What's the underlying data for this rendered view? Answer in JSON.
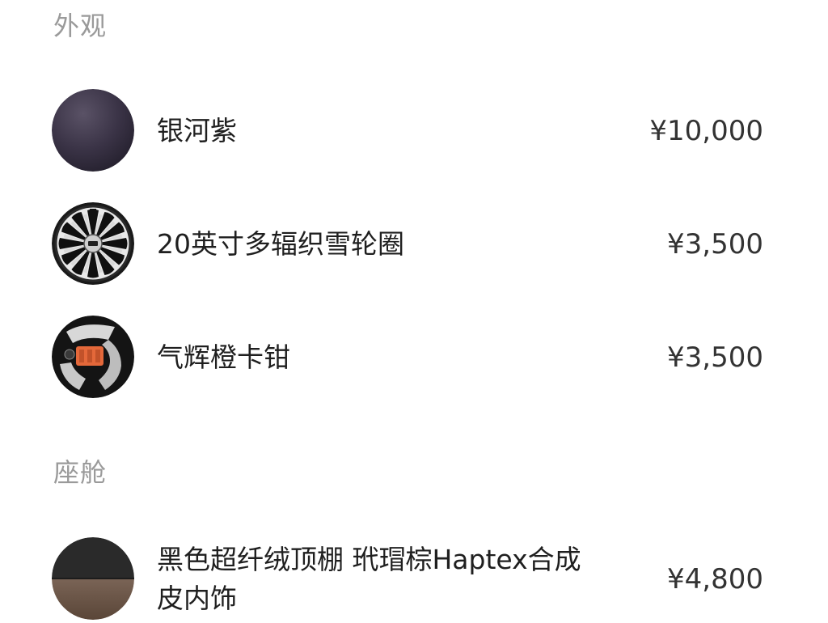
{
  "sections": [
    {
      "title": "外观",
      "items": [
        {
          "name": "银河紫",
          "price": "¥10,000",
          "thumb": "paint-swatch-icon"
        },
        {
          "name": "20英寸多辐织雪轮圈",
          "price": "¥3,500",
          "thumb": "wheel-rim-icon"
        },
        {
          "name": "气辉橙卡钳",
          "price": "¥3,500",
          "thumb": "brake-caliper-icon"
        }
      ]
    },
    {
      "title": "座舱",
      "items": [
        {
          "name_line1": "黑色超纤绒顶棚 玳瑁棕Haptex合成",
          "name_line2": "皮内饰",
          "price": "¥4,800",
          "thumb": "interior-swatch-icon"
        }
      ]
    }
  ],
  "colors": {
    "galaxy_purple": "#3a3346",
    "caliper_orange": "#e4683a",
    "headliner_black": "#2a2a2a",
    "leather_brown": "#6a5648"
  }
}
